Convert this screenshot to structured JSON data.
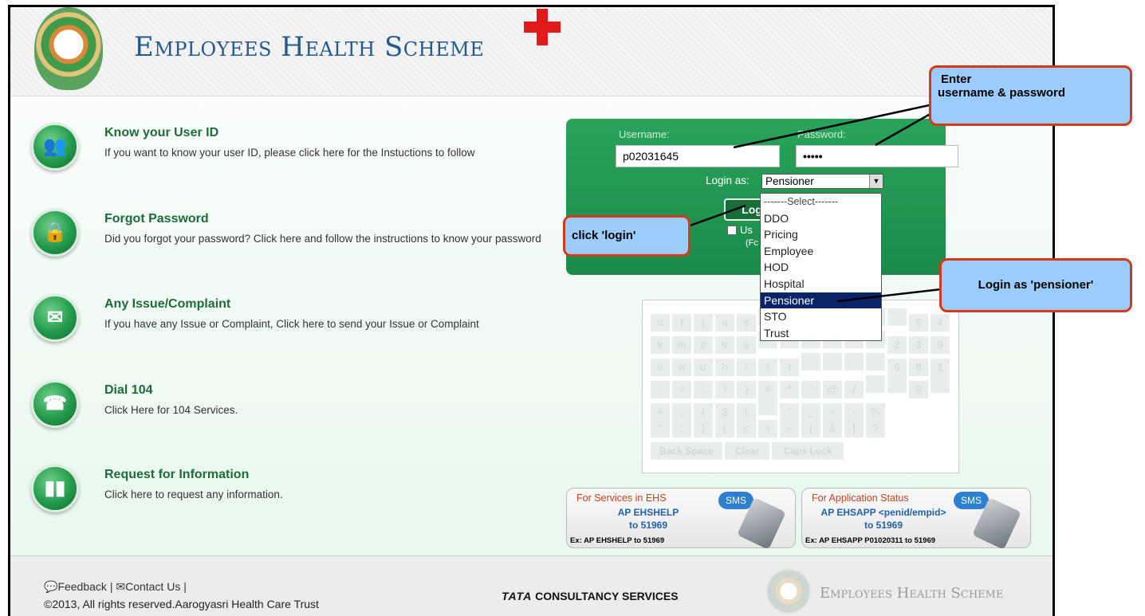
{
  "header": {
    "title": "Employees Health Scheme"
  },
  "items": [
    {
      "heading": "Know your User ID",
      "desc": "If you want to know your user ID, please click here for the Instuctions to follow",
      "icon": "users-icon"
    },
    {
      "heading": "Forgot Password",
      "desc": "Did you forgot your password? Click here and follow the instructions to know your password",
      "icon": "lock-icon"
    },
    {
      "heading": "Any Issue/Complaint",
      "desc": "If you have any Issue or Complaint, Click here to send your Issue or Complaint",
      "icon": "envelope-pen-icon"
    },
    {
      "heading": "Dial 104",
      "desc": "Click Here for 104 Services.",
      "icon": "telephone-icon"
    },
    {
      "heading": "Request for Information",
      "desc": "Click here to request any information.",
      "icon": "info-books-icon"
    }
  ],
  "login": {
    "username_label": "Username:",
    "password_label": "Password:",
    "username_value": "p02031645",
    "password_value": "•••••",
    "login_as_label": "Login as:",
    "login_as_value": "Pensioner",
    "button_label": "Log",
    "checkbox_label": "Us",
    "checkbox_note": "(Fc"
  },
  "dropdown": {
    "options": [
      "-------Select-------",
      "DDO",
      "Pricing",
      "Employee",
      "HOD",
      "Hospital",
      "Pensioner",
      "STO",
      "Trust"
    ],
    "selected": "Pensioner"
  },
  "keyboard": {
    "rows": [
      [
        "d",
        "f",
        "j",
        "o",
        "s",
        "",
        "",
        "",
        "",
        "",
        "",
        "",
        "5",
        "4"
      ],
      [
        "k",
        "m",
        "c",
        "v",
        "a",
        "",
        "",
        "",
        "",
        "",
        "",
        "2",
        "3",
        "9"
      ],
      [
        "e",
        "w",
        "u",
        "h",
        "i",
        "l",
        "t",
        "",
        "",
        "",
        "",
        "6",
        "8",
        "1"
      ],
      [
        ",",
        ">",
        ":",
        "!",
        ")",
        "#",
        "^",
        "'",
        "@",
        "/",
        "",
        "",
        "0",
        ""
      ],
      [
        "+",
        ".",
        "{",
        "$",
        "[",
        "",
        "`",
        "_",
        "=",
        "-",
        "%"
      ],
      [
        "\"",
        ";",
        "}",
        "(",
        "<",
        "\\",
        "~",
        "|",
        "&",
        "]",
        "?"
      ]
    ],
    "back_space": "Back Space",
    "clear": "Clear",
    "caps_lock": "Caps Lock"
  },
  "sms": [
    {
      "title": "For Services in EHS",
      "line1": "AP EHSHELP",
      "line2": "to 51969",
      "example": "Ex: AP EHSHELP to 51969",
      "badge": "SMS"
    },
    {
      "title": "For Application Status",
      "line1": "AP EHSAPP <penid/empid>",
      "line2": "to 51969",
      "example": "Ex: AP EHSAPP P01020311 to 51969",
      "badge": "SMS"
    }
  ],
  "footer": {
    "feedback": "Feedback",
    "contact": "Contact Us",
    "copyright": "©2013, All rights reserved.Aarogyasri Health Care Trust",
    "tcs": "TATA CONSULTANCY SERVICES",
    "tcs_brand": "TATA",
    "tcs_rest": "CONSULTANCY SERVICES",
    "brand": "Employees Health Scheme"
  },
  "callouts": {
    "enter": "Enter",
    "enter2": "username & password",
    "click_login": "click 'login'",
    "login_as": "Login as 'pensioner'"
  },
  "colors": {
    "accent_green": "#1b8a49",
    "callout_fill": "#9cccfb",
    "callout_border": "#d23a1a",
    "selected_option": "#0a246a"
  }
}
